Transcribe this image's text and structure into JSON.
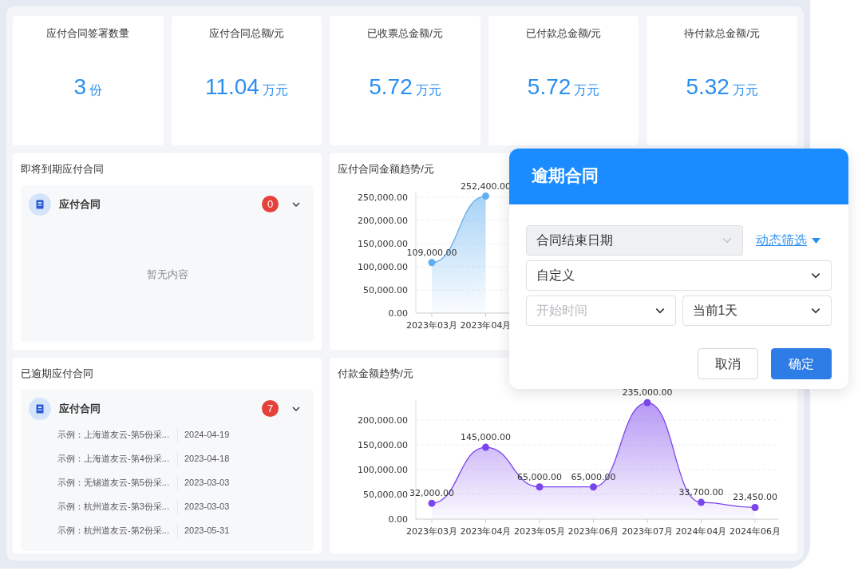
{
  "stats": [
    {
      "label": "应付合同签署数量",
      "value": "3",
      "unit": "份"
    },
    {
      "label": "应付合同总额/元",
      "value": "11.04",
      "unit": "万元"
    },
    {
      "label": "已收票总金额/元",
      "value": "5.72",
      "unit": "万元"
    },
    {
      "label": "已付款总金额/元",
      "value": "5.72",
      "unit": "万元"
    },
    {
      "label": "待付款总金额/元",
      "value": "5.32",
      "unit": "万元"
    }
  ],
  "upcoming": {
    "title": "即将到期应付合同",
    "group": {
      "label": "应付合同",
      "count": "0"
    },
    "empty_text": "暂无内容"
  },
  "amount_trend": {
    "title": "应付合同金额趋势/元",
    "chart_data": {
      "type": "area",
      "categories": [
        "2023年03月",
        "2023年04月"
      ],
      "series": [
        {
          "color": "#62aef0",
          "values": [
            109000,
            252400
          ]
        }
      ],
      "ylim": [
        0,
        260000
      ],
      "grid": true,
      "value_labels": [
        "109,000.00",
        "252,400.00"
      ],
      "yticks": [
        {
          "value": 0,
          "label": "0.00"
        },
        {
          "value": 50000,
          "label": "50,000.00"
        },
        {
          "value": 100000,
          "label": "100,000.00"
        },
        {
          "value": 150000,
          "label": "150,000.00"
        },
        {
          "value": 200000,
          "label": "200,000.00"
        },
        {
          "value": 250000,
          "label": "250,000.00"
        }
      ]
    }
  },
  "overdue": {
    "title": "已逾期应付合同",
    "group": {
      "label": "应付合同",
      "count": "7"
    },
    "items": [
      {
        "name": "示例：上海道友云-第5份采...",
        "date": "2024-04-19"
      },
      {
        "name": "示例：上海道友云-第4份采...",
        "date": "2023-04-18"
      },
      {
        "name": "示例：无锡道友云-第5份采...",
        "date": "2023-03-03"
      },
      {
        "name": "示例：杭州道友云-第3份采...",
        "date": "2023-03-03"
      },
      {
        "name": "示例：杭州道友云-第2份采...",
        "date": "2023-05-31"
      }
    ]
  },
  "payment_trend": {
    "title": "付款金额趋势/元",
    "chart_data": {
      "type": "area",
      "categories": [
        "2023年03月",
        "2023年04月",
        "2023年05月",
        "2023年06月",
        "2023年07月",
        "2024年04月",
        "2024年06月"
      ],
      "series": [
        {
          "color": "#7b45ec",
          "values": [
            32000,
            145000,
            65000,
            65000,
            235000,
            33700,
            23450
          ]
        }
      ],
      "ylim": [
        0,
        240000
      ],
      "grid": true,
      "value_labels": [
        "32,000.00",
        "145,000.00",
        "65,000.00",
        "65,000.00",
        "235,000.00",
        "33,700.00",
        "23,450.00"
      ],
      "yticks": [
        {
          "value": 0,
          "label": "0.00"
        },
        {
          "value": 50000,
          "label": "50,000.00"
        },
        {
          "value": 100000,
          "label": "100,000.00"
        },
        {
          "value": 150000,
          "label": "150,000.00"
        },
        {
          "value": 200000,
          "label": "200,000.00"
        }
      ]
    }
  },
  "dialog": {
    "title": "逾期合同",
    "field": {
      "value": "合同结束日期",
      "disabled": true
    },
    "filter_link": "动态筛选",
    "range_type": {
      "value": "自定义"
    },
    "start": {
      "placeholder": "开始时间"
    },
    "offset": {
      "value": "当前1天"
    },
    "buttons": [
      {
        "label": "取消",
        "kind": "secondary"
      },
      {
        "label": "确定",
        "kind": "primary"
      }
    ]
  }
}
